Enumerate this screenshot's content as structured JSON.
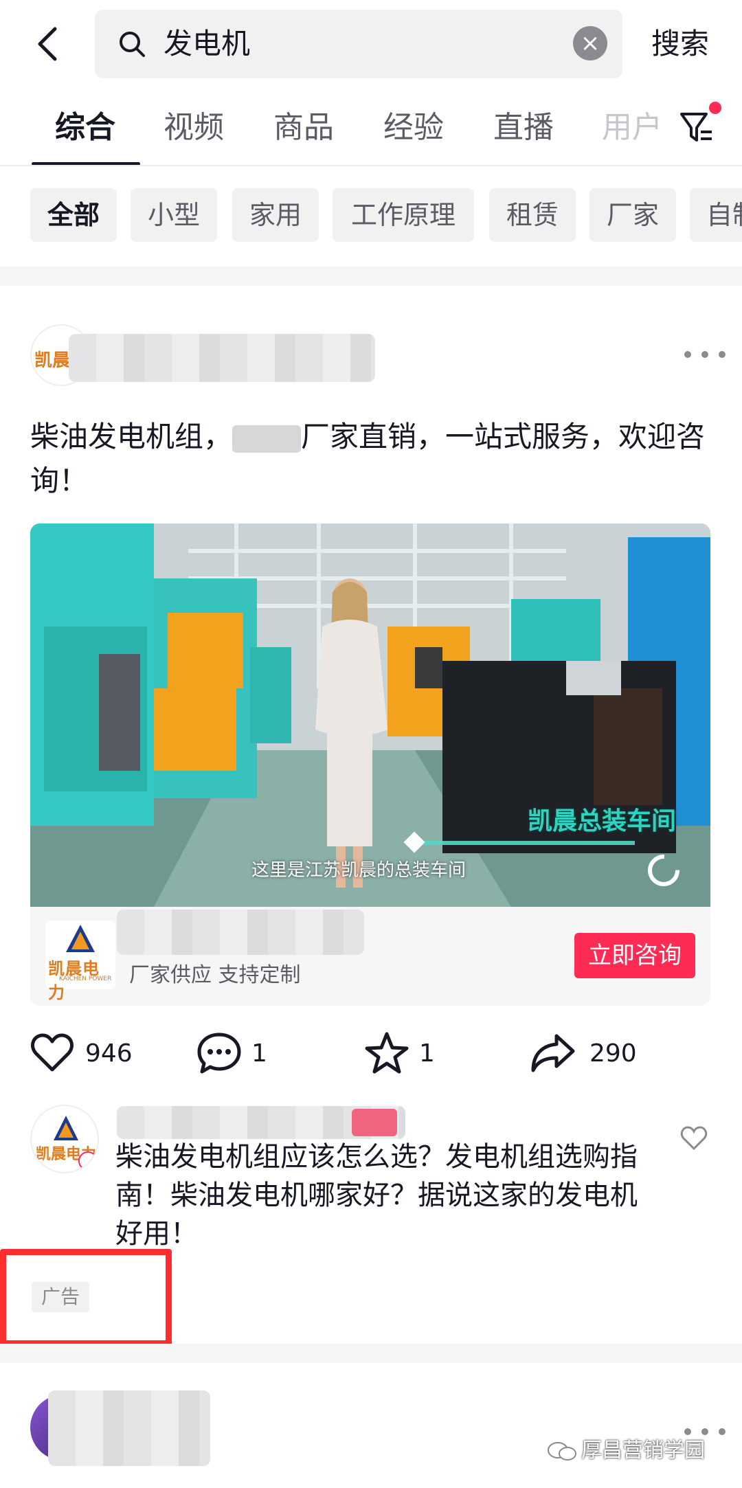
{
  "search": {
    "query": "发电机",
    "button_label": "搜索"
  },
  "tabs": [
    {
      "label": "综合",
      "active": true
    },
    {
      "label": "视频"
    },
    {
      "label": "商品"
    },
    {
      "label": "经验"
    },
    {
      "label": "直播"
    },
    {
      "label": "用户"
    }
  ],
  "chips": [
    {
      "label": "全部",
      "active": true
    },
    {
      "label": "小型"
    },
    {
      "label": "家用"
    },
    {
      "label": "工作原理"
    },
    {
      "label": "租赁"
    },
    {
      "label": "厂家"
    },
    {
      "label": "自制"
    }
  ],
  "post": {
    "avatar_text": "凯晨",
    "desc_before": "柴油发电机组，",
    "desc_after": "厂家直销，一站式服务，欢迎咨询！",
    "video": {
      "caption": "这里是江苏凯晨的总装车间",
      "overlay_title": "凯晨总装车间"
    },
    "ad_card": {
      "logo_text": "凯晨电力",
      "logo_sub": "KAICHEN POWER",
      "subtitle": "厂家供应 支持定制",
      "cta": "立即咨询"
    },
    "stats": {
      "likes": "946",
      "comments": "1",
      "favorites": "1",
      "shares": "290"
    }
  },
  "comment": {
    "avatar_text": "凯晨电力",
    "text": "柴油发电机组应该怎么选？发电机组选购指南！柴油发电机哪家好？据说这家的发电机好用！",
    "ad_label": "广告"
  },
  "watermark": "厚昌营销学园",
  "colors": {
    "accent": "#fe2c55",
    "highlight_box": "#ff2d2d"
  }
}
